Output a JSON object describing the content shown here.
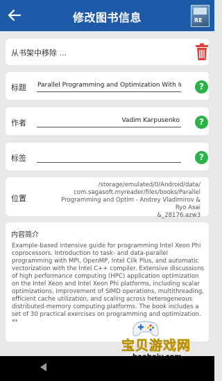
{
  "header": {
    "title": "修改图书信息",
    "back_icon": "arrow-left-icon",
    "cover_label": "RE",
    "bar_color": "#1e5aa8"
  },
  "remove": {
    "label": "从书架中移除 ...",
    "icon": "trash-icon",
    "icon_color": "#e2403a"
  },
  "fields": {
    "title": {
      "label": "标题",
      "value": "Parallel Programming and Optimization With Intel"
    },
    "author": {
      "label": "作者",
      "value": "Vadim Karpusenko"
    },
    "tags": {
      "label": "标签",
      "value": ""
    },
    "help_glyph": "?",
    "help_color": "#2bb34a"
  },
  "location": {
    "label": "位置",
    "path_lines": [
      "/storage/emulated/0/Android/data/",
      "com.sagasoft.myreader/files/books/Parallel",
      "Programming and Optim - Andrey Vladimirov & Ryo Asai",
      "&_28176.azw3"
    ]
  },
  "description": {
    "label": "内容简介",
    "text": "Example-based intensive guide for programming Intel Xeon Phi coprocessors. Introduction to task- and data-parallel programming with MPI, OpenMP, Intel Cilk Plus, and automatic vectorization with the Intel C++ compiler. Extensive discussions of high performance computing (HPC) application optimization on the Intel Xeon and Intel Xeon Phi platforms, including scalar optimizations, improvement of SIMD operations, multithreading, efficient cache utilization, and scaling across heterogeneous distributed-memory computing platforms. The book includes a set of 30 practical exercises on programming and optimization. **"
  },
  "watermark": {
    "text": "宝贝游戏网",
    "url": "baobeiy.com",
    "icon": "gamepad-icon"
  },
  "system_nav": {
    "back_icon": "nav-back-icon"
  }
}
